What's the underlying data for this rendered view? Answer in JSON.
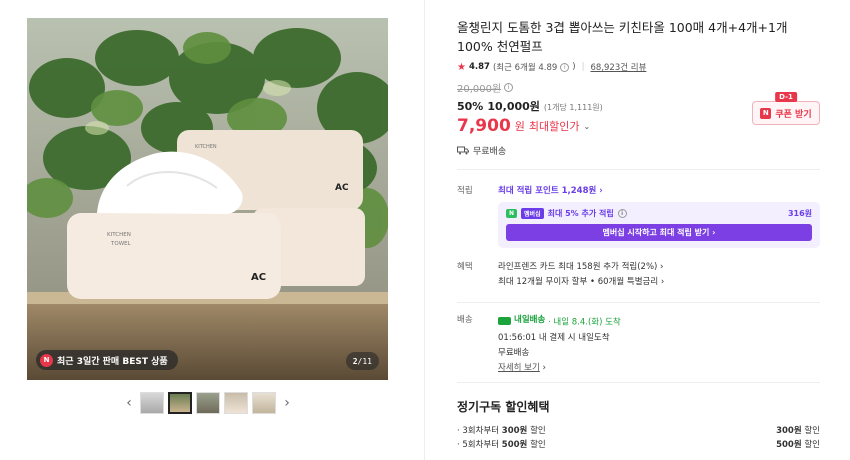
{
  "gallery": {
    "badge_icon": "N",
    "badge": "최근 3일간 판매 BEST 상품",
    "counter_current": "2",
    "counter_total": "/11",
    "package_text_line1": "KITCHEN",
    "package_text_line2": "TOWEL",
    "package_logo": "AC",
    "prev": "‹",
    "next": "›"
  },
  "product": {
    "title": "올챙린지 도톰한 3겹 뽑아쓰는 키친타올 100매 4개+4개+1개 100% 천연펄프",
    "rating": "4.87",
    "rating_recent": "(최근 6개월 4.89",
    "rating_recent_close": ")",
    "review_count": "68,923건 리뷰",
    "original_price": "20,000원",
    "discount": "50%",
    "sale_price": "10,000원",
    "unit_price": "(1개당 1,111원)",
    "final_price": "7,900",
    "final_unit": "원",
    "final_label": "최대할인가",
    "shipping": "무료배송"
  },
  "coupon": {
    "dday": "D-1",
    "icon": "N",
    "label": "쿠폰 받기"
  },
  "points": {
    "label": "적립",
    "max_points": "최대 적립 포인트 1,248원",
    "membership_badge1": "N",
    "membership_badge2": "멤버십",
    "membership_text": "최대 5% 추가 적립",
    "membership_amount": "316원",
    "membership_button": "멤버십 시작하고 최대 적립 받기"
  },
  "benefits": {
    "label": "혜택",
    "line1": "라인프렌즈 카드 최대 158원 추가 적립(2%)",
    "line2": "최대 12개월 무이자 할부 • 60개월 특별금리"
  },
  "delivery": {
    "label": "배송",
    "tag": "내일배송",
    "eta": "· 내일 8.4.(화) 도착",
    "timer": "01:56:01",
    "timer_text": "내 결제 시 내일도착",
    "free": "무료배송",
    "more": "자세히 보기"
  },
  "subscription": {
    "title": "정기구독 할인혜택",
    "rows": [
      {
        "prefix": "· 3회차부터 ",
        "bold": "300원",
        "suffix": " 할인",
        "right_bold": "300원",
        "right_suffix": " 할인"
      },
      {
        "prefix": "· 5회차부터 ",
        "bold": "500원",
        "suffix": " 할인",
        "right_bold": "500원",
        "right_suffix": " 할인"
      }
    ]
  }
}
